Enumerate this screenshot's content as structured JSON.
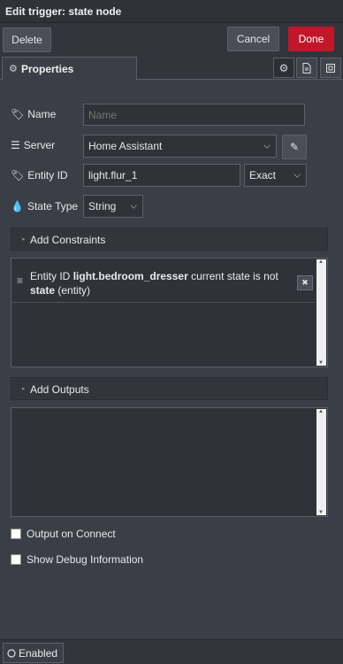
{
  "window": {
    "title": "Edit trigger: state node"
  },
  "toolbar": {
    "delete_label": "Delete",
    "cancel_label": "Cancel",
    "done_label": "Done"
  },
  "tabs": {
    "properties_label": "Properties"
  },
  "form": {
    "name": {
      "label": "Name",
      "value": "",
      "placeholder": "Name"
    },
    "server": {
      "label": "Server",
      "value": "Home Assistant"
    },
    "entity_id": {
      "label": "Entity ID",
      "value": "light.flur_1",
      "match": "Exact"
    },
    "state_type": {
      "label": "State Type",
      "value": "String"
    }
  },
  "constraints": {
    "header": "Add Constraints",
    "items": [
      {
        "prefix": "Entity ID",
        "entity": "light.bedroom_dresser",
        "middle": "current state is not",
        "target": "state",
        "suffix": "(entity)"
      }
    ]
  },
  "outputs": {
    "header": "Add Outputs"
  },
  "options": {
    "output_on_connect": {
      "label": "Output on Connect",
      "checked": false
    },
    "show_debug": {
      "label": "Show Debug Information",
      "checked": false
    }
  },
  "footer": {
    "enabled_label": "Enabled"
  },
  "colors": {
    "done": "#c2162a",
    "background": "#3a3f47",
    "panel": "#32363c"
  }
}
